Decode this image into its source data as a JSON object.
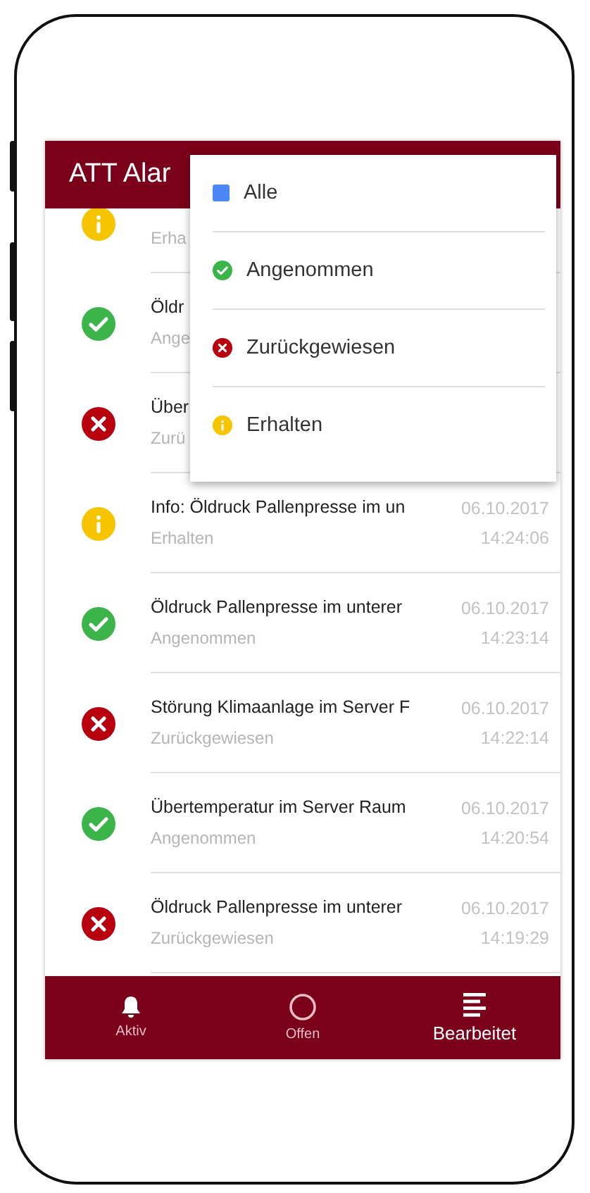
{
  "header": {
    "title": "ATT Alar"
  },
  "alarms": [
    {
      "kind": "info",
      "subtitle": "Erha"
    },
    {
      "kind": "accepted",
      "title": "Öldr",
      "subtitle": "Ange"
    },
    {
      "kind": "rejected",
      "title": "Über",
      "subtitle": "Zurü"
    },
    {
      "kind": "info",
      "title": "Info: Öldruck Pallenpresse im un",
      "subtitle": "Erhalten",
      "date": "06.10.2017",
      "time": "14:24:06"
    },
    {
      "kind": "accepted",
      "title": "Öldruck Pallenpresse im unterer",
      "subtitle": "Angenommen",
      "date": "06.10.2017",
      "time": "14:23:14"
    },
    {
      "kind": "rejected",
      "title": "Störung Klimaanlage im Server F",
      "subtitle": "Zurückgewiesen",
      "date": "06.10.2017",
      "time": "14:22:14"
    },
    {
      "kind": "accepted",
      "title": "Übertemperatur im Server Raum",
      "subtitle": "Angenommen",
      "date": "06.10.2017",
      "time": "14:20:54"
    },
    {
      "kind": "rejected",
      "title": "Öldruck Pallenpresse im unterer",
      "subtitle": "Zurückgewiesen",
      "date": "06.10.2017",
      "time": "14:19:29"
    }
  ],
  "filter_menu": [
    {
      "kind": "all",
      "label": "Alle"
    },
    {
      "kind": "accepted",
      "label": "Angenommen"
    },
    {
      "kind": "rejected",
      "label": "Zurückgewiesen"
    },
    {
      "kind": "info",
      "label": "Erhalten"
    }
  ],
  "bottom_nav": [
    {
      "kind": "bell",
      "label": "Aktiv",
      "selected": false
    },
    {
      "kind": "circle",
      "label": "Offen",
      "selected": false
    },
    {
      "kind": "list",
      "label": "Bearbeitet",
      "selected": true
    }
  ]
}
